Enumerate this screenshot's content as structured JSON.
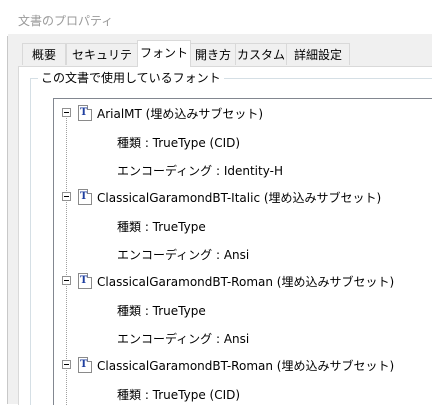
{
  "window": {
    "title": "文書のプロパティ"
  },
  "tabs": [
    {
      "label": "概要"
    },
    {
      "label": "セキュリティ"
    },
    {
      "label": "フォント"
    },
    {
      "label": "開き方"
    },
    {
      "label": "カスタム"
    },
    {
      "label": "詳細設定"
    }
  ],
  "active_tab": "フォント",
  "group": {
    "label": "この文書で使用しているフォント"
  },
  "fonts": [
    {
      "name": "ArialMT (埋め込みサブセット)",
      "type": "種類 : TrueType (CID)",
      "encoding": "エンコーディング : Identity-H",
      "icon": "T"
    },
    {
      "name": "ClassicalGaramondBT-Italic (埋め込みサブセット)",
      "type": "種類 : TrueType",
      "encoding": "エンコーディング : Ansi",
      "icon": "T"
    },
    {
      "name": "ClassicalGaramondBT-Roman (埋め込みサブセット)",
      "type": "種類 : TrueType",
      "encoding": "エンコーディング : Ansi",
      "icon": "T"
    },
    {
      "name": "ClassicalGaramondBT-Roman (埋め込みサブセット)",
      "type": "種類 : TrueType (CID)",
      "icon": "T"
    }
  ],
  "colors": {
    "icon_text": "#1f3fa0",
    "title_text": "#9a9a9a",
    "panel_bg": "#f0f0f0"
  },
  "icons": {
    "expander": "collapse-minus-icon",
    "font": "truetype-font-icon"
  }
}
